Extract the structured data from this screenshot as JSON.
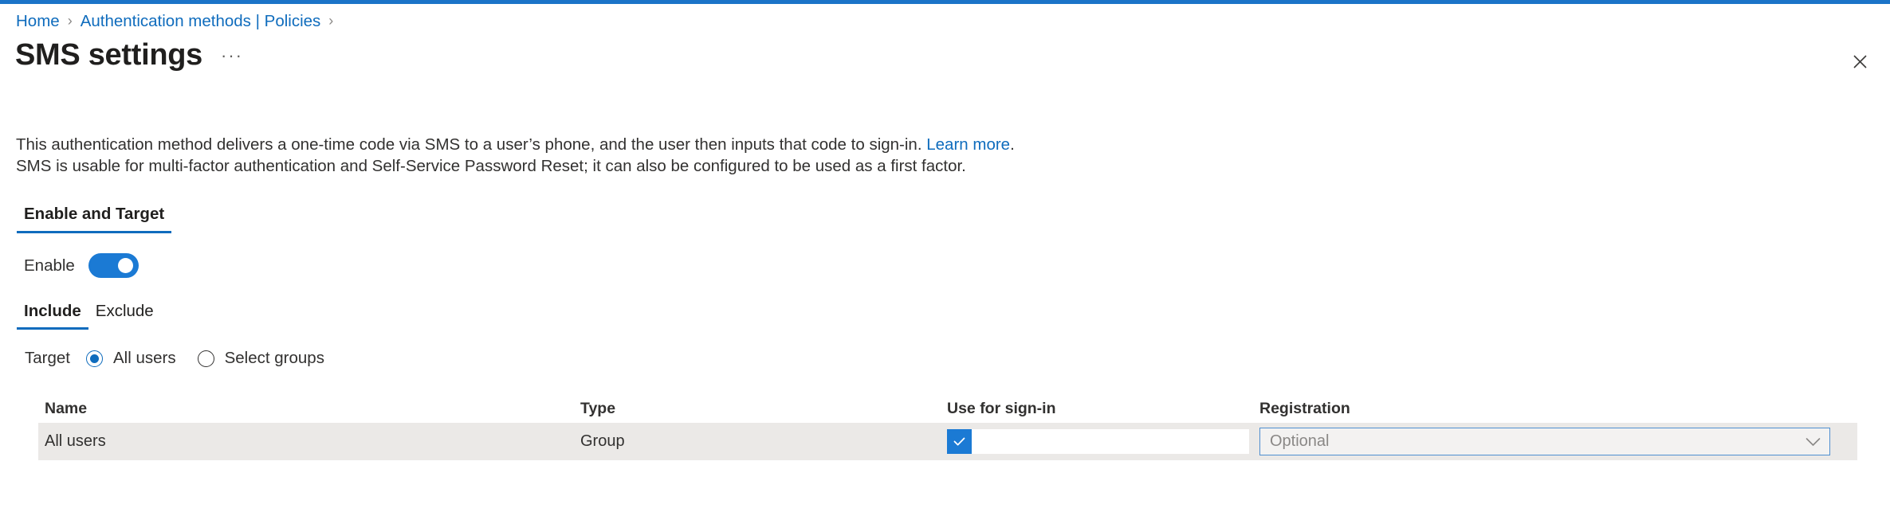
{
  "theme": {
    "accent": "#1b74c8",
    "link": "#0f6cbd",
    "toggle_on": "#1b7ad4",
    "row_bg": "#ebe9e7",
    "text": "#323130"
  },
  "breadcrumb": {
    "items": [
      {
        "label": "Home"
      },
      {
        "label": "Authentication methods | Policies"
      }
    ],
    "separator": "›"
  },
  "header": {
    "title": "SMS settings",
    "more_label": "···",
    "close_label": "Close"
  },
  "description": {
    "line1_before_link": "This authentication method delivers a one-time code via SMS to a user’s phone, and the user then inputs that code to sign-in. ",
    "link_text": "Learn more",
    "line1_after_link": ".",
    "line2": "SMS is usable for multi-factor authentication and Self-Service Password Reset; it can also be configured to be used as a first factor."
  },
  "pivot": {
    "items": [
      {
        "label": "Enable and Target",
        "selected": true
      }
    ]
  },
  "enable": {
    "label": "Enable",
    "state": "on"
  },
  "subtabs": {
    "items": [
      {
        "label": "Include",
        "selected": true
      },
      {
        "label": "Exclude",
        "selected": false
      }
    ]
  },
  "target": {
    "label": "Target",
    "options": [
      {
        "label": "All users",
        "checked": true
      },
      {
        "label": "Select groups",
        "checked": false
      }
    ]
  },
  "table": {
    "columns": [
      {
        "key": "name",
        "label": "Name"
      },
      {
        "key": "type",
        "label": "Type"
      },
      {
        "key": "signin",
        "label": "Use for sign-in"
      },
      {
        "key": "registration",
        "label": "Registration"
      }
    ],
    "rows": [
      {
        "name": "All users",
        "type": "Group",
        "signin_checked": true,
        "registration_value": "Optional"
      }
    ]
  }
}
